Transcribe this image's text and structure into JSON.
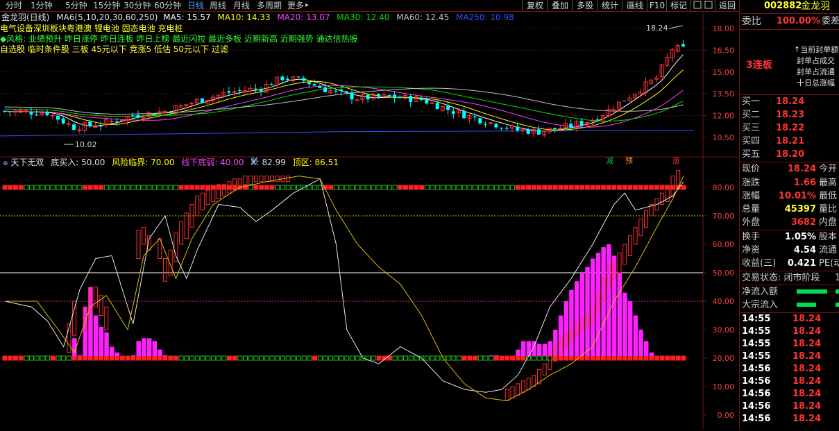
{
  "toolbar": {
    "periods": [
      "分时",
      "1分钟",
      "5分钟",
      "15分钟",
      "30分钟",
      "60分钟",
      "日线",
      "周线",
      "月线",
      "多周期",
      "更多"
    ],
    "active_period": "日线",
    "more_caret": "▸",
    "buttons": [
      "复权",
      "叠加",
      "多股",
      "统计",
      "画线",
      "F10",
      "标记",
      "返回"
    ]
  },
  "chart": {
    "title": "金龙羽(日线)",
    "ma_label": "MA6(5,10,20,30,60,250)",
    "ma_values": [
      {
        "text": "MA5: 15.57",
        "color": "#ffffff"
      },
      {
        "text": "MA10: 14.33",
        "color": "#ffff00"
      },
      {
        "text": "MA20: 13.07",
        "color": "#ff40ff"
      },
      {
        "text": "MA30: 12.40",
        "color": "#00e000"
      },
      {
        "text": "MA60: 12.45",
        "color": "#c0c0c0"
      },
      {
        "text": "MA250: 10.98",
        "color": "#3050ff"
      }
    ],
    "concept_line": "电气设备深圳板块粤港澳 锂电池 固态电池 充电桩",
    "style_line": "◆风格: 业绩预升 昨日涨停 昨日连板 昨日上榜 最近闪拉 最近多板 近期新高 近期强势 通达信热股",
    "tag_line": "自选股 临时条件股 三板 45元以下 竞涨5 低估 50元以下 过滤",
    "high_label": "18.24",
    "low_label": "10.02",
    "markers": [
      "财",
      "减",
      "预",
      "涨"
    ],
    "main_axis": [
      "18.00",
      "16.50",
      "15.00",
      "13.50",
      "12.00",
      "10.50"
    ],
    "lower_axis": [
      "80.00",
      "70.00",
      "60.00",
      "50.00",
      "40.00",
      "30.00",
      "20.00",
      "10.00",
      "0.00"
    ],
    "indicator": {
      "name": "天下无双",
      "items": [
        {
          "text": "底买入: 50.00",
          "color": "#e0e0e0"
        },
        {
          "text": "风险临界: 70.00",
          "color": "#ffff00"
        },
        {
          "text": "线下底弱: 40.00",
          "color": "#ff40ff"
        },
        {
          "text": "X: 82.99",
          "color": "#e0e0e0"
        },
        {
          "text": "顶区: 86.51",
          "color": "#ffff00"
        }
      ]
    }
  },
  "chart_data": {
    "type": "candlestick",
    "main_price_axis": [
      18.0,
      16.5,
      15.0,
      13.5,
      12.0,
      10.5
    ],
    "high": 18.24,
    "low": 10.02,
    "indicator_axis": [
      80,
      70,
      60,
      50,
      40,
      30,
      20,
      10,
      0
    ],
    "indicator_params": {
      "底买入": 50.0,
      "风险临界": 70.0,
      "线下底弱": 40.0,
      "X": 82.99,
      "顶区": 86.51
    }
  },
  "panel": {
    "code": "002882",
    "name": "金龙羽",
    "ratio_label": "委比",
    "ratio_value": "100.00%",
    "ratio_extra": "委差",
    "board_label": "3连板",
    "board_notes": [
      "↑当前封单额",
      "封单占成交",
      "封单占流通",
      "十日总涨幅"
    ],
    "bids": [
      {
        "label": "买一",
        "price": "18.24"
      },
      {
        "label": "买二",
        "price": "18.23"
      },
      {
        "label": "买三",
        "price": "18.22"
      },
      {
        "label": "买四",
        "price": "18.21"
      },
      {
        "label": "买五",
        "price": "18.20"
      }
    ],
    "quote": [
      {
        "label": "现价",
        "value": "18.24",
        "color": "#ff3333",
        "extra": "今开"
      },
      {
        "label": "涨跌",
        "value": "1.66",
        "color": "#ff3333",
        "extra": "最高"
      },
      {
        "label": "涨幅",
        "value": "10.01%",
        "color": "#ff3333",
        "extra": "最低"
      },
      {
        "label": "总量",
        "value": "45397",
        "color": "#ffff33",
        "extra": "量比"
      },
      {
        "label": "外盘",
        "value": "3682",
        "color": "#ff3333",
        "extra": "内盘"
      }
    ],
    "quote2": [
      {
        "label": "换手",
        "value": "1.05%",
        "color": "#ffffff",
        "extra": "股本"
      },
      {
        "label": "净资",
        "value": "4.54",
        "color": "#ffffff",
        "extra": "流通"
      },
      {
        "label": "收益(三)",
        "value": "0.421",
        "color": "#ffffff",
        "extra": "PE(动"
      }
    ],
    "trade_status": "交易状态: 闭市阶段",
    "trade_status_extra": "1",
    "flows": [
      {
        "label": "净流入额",
        "color": "#00e04a"
      },
      {
        "label": "大宗流入",
        "color": "#00e04a"
      }
    ],
    "ticks": [
      {
        "time": "14:55",
        "price": "18.24"
      },
      {
        "time": "14:55",
        "price": "18.24"
      },
      {
        "time": "14:55",
        "price": "18.24"
      },
      {
        "time": "14:55",
        "price": "18.24"
      },
      {
        "time": "14:56",
        "price": "18.24"
      },
      {
        "time": "14:56",
        "price": "18.24"
      },
      {
        "time": "14:56",
        "price": "18.24"
      },
      {
        "time": "14:56",
        "price": "18.24"
      },
      {
        "time": "14:56",
        "price": "18.24"
      }
    ]
  }
}
